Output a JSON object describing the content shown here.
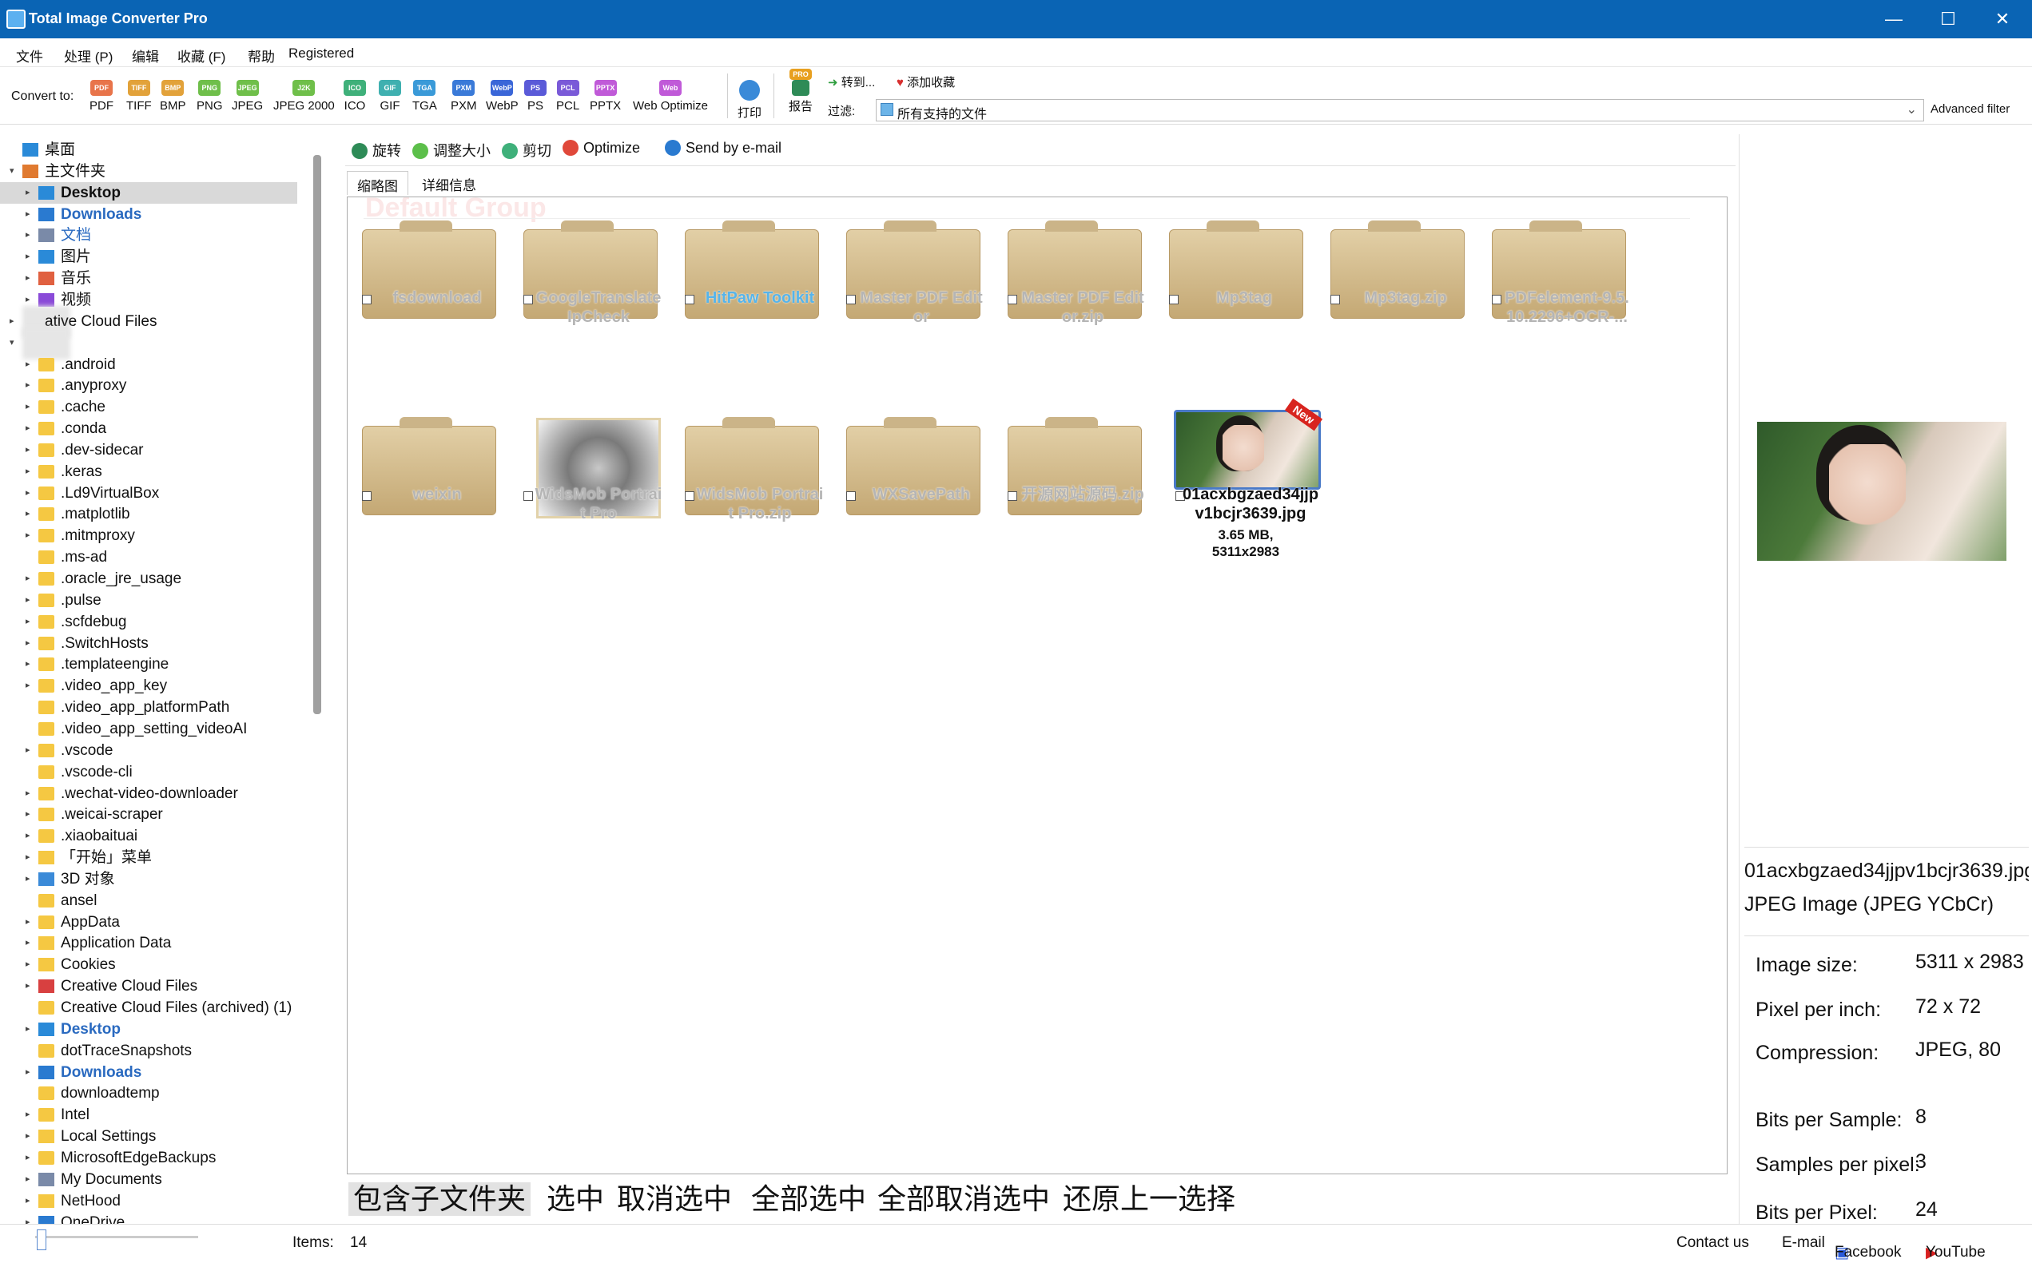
{
  "window": {
    "title": "Total Image Converter Pro",
    "minimize": "—",
    "maximize": "☐",
    "close": "✕"
  },
  "menu": [
    "文件",
    "处理 (P)",
    "编辑",
    "收藏 (F)",
    "帮助",
    "Registered"
  ],
  "toolbar": {
    "convert_to": "Convert to:",
    "formats": [
      {
        "label": "PDF",
        "icon": "PDF",
        "color": "#e8744a"
      },
      {
        "label": "TIFF",
        "icon": "TIFF",
        "color": "#e2a23a"
      },
      {
        "label": "BMP",
        "icon": "BMP",
        "color": "#e2a23a"
      },
      {
        "label": "PNG",
        "icon": "PNG",
        "color": "#6fbf4a"
      },
      {
        "label": "JPEG",
        "icon": "JPEG",
        "color": "#6fbf4a"
      },
      {
        "label": "JPEG 2000",
        "icon": "J2K",
        "color": "#6fbf4a"
      },
      {
        "label": "ICO",
        "icon": "ICO",
        "color": "#3fb07a"
      },
      {
        "label": "GIF",
        "icon": "GIF",
        "color": "#3fb0b0"
      },
      {
        "label": "TGA",
        "icon": "TGA",
        "color": "#3a9ad8"
      },
      {
        "label": "PXM",
        "icon": "PXM",
        "color": "#3a7ad8"
      },
      {
        "label": "WebP",
        "icon": "WebP",
        "color": "#3a66d8"
      },
      {
        "label": "PS",
        "icon": "PS",
        "color": "#5a5ad8"
      },
      {
        "label": "PCL",
        "icon": "PCL",
        "color": "#7a5ad8"
      },
      {
        "label": "PPTX",
        "icon": "PPTX",
        "color": "#c05ad8"
      },
      {
        "label": "Web Optimize",
        "icon": "Web",
        "color": "#c05ad8"
      }
    ],
    "print": "打印",
    "report": "报告",
    "pro_badge": "PRO",
    "goto": "转到...",
    "add_favorite": "添加收藏",
    "filter_label": "过滤:",
    "filter_value": "所有支持的文件",
    "advanced_filter": "Advanced filter"
  },
  "tree": {
    "items": [
      {
        "label": "桌面",
        "exp": "",
        "level": 0,
        "icon": "desktop"
      },
      {
        "label": "主文件夹",
        "exp": "▾",
        "level": 0,
        "icon": "home"
      },
      {
        "label": "Desktop",
        "exp": "▸",
        "level": 1,
        "icon": "desktop",
        "style": "selected"
      },
      {
        "label": "Downloads",
        "exp": "▸",
        "level": 1,
        "icon": "download",
        "style": "blue"
      },
      {
        "label": "文档",
        "exp": "▸",
        "level": 1,
        "icon": "doc",
        "style": "blue"
      },
      {
        "label": "图片",
        "exp": "▸",
        "level": 1,
        "icon": "pic"
      },
      {
        "label": "音乐",
        "exp": "▸",
        "level": 1,
        "icon": "music"
      },
      {
        "label": "视频",
        "exp": "▸",
        "level": 1,
        "icon": "video"
      },
      {
        "label": "ative Cloud Files",
        "exp": "▸",
        "level": 0,
        "icon": "blur"
      },
      {
        "label": "",
        "exp": "▾",
        "level": 0,
        "icon": "blur"
      },
      {
        "label": ".android",
        "exp": "▸",
        "level": 1,
        "icon": "folder"
      },
      {
        "label": ".anyproxy",
        "exp": "▸",
        "level": 1,
        "icon": "folder"
      },
      {
        "label": ".cache",
        "exp": "▸",
        "level": 1,
        "icon": "folder"
      },
      {
        "label": ".conda",
        "exp": "▸",
        "level": 1,
        "icon": "folder"
      },
      {
        "label": ".dev-sidecar",
        "exp": "▸",
        "level": 1,
        "icon": "folder"
      },
      {
        "label": ".keras",
        "exp": "▸",
        "level": 1,
        "icon": "folder"
      },
      {
        "label": ".Ld9VirtualBox",
        "exp": "▸",
        "level": 1,
        "icon": "folder"
      },
      {
        "label": ".matplotlib",
        "exp": "▸",
        "level": 1,
        "icon": "folder"
      },
      {
        "label": ".mitmproxy",
        "exp": "▸",
        "level": 1,
        "icon": "folder"
      },
      {
        "label": ".ms-ad",
        "exp": "",
        "level": 1,
        "icon": "folder"
      },
      {
        "label": ".oracle_jre_usage",
        "exp": "▸",
        "level": 1,
        "icon": "folder"
      },
      {
        "label": ".pulse",
        "exp": "▸",
        "level": 1,
        "icon": "folder"
      },
      {
        "label": ".scfdebug",
        "exp": "▸",
        "level": 1,
        "icon": "folder"
      },
      {
        "label": ".SwitchHosts",
        "exp": "▸",
        "level": 1,
        "icon": "folder"
      },
      {
        "label": ".templateengine",
        "exp": "▸",
        "level": 1,
        "icon": "folder"
      },
      {
        "label": ".video_app_key",
        "exp": "▸",
        "level": 1,
        "icon": "folder"
      },
      {
        "label": ".video_app_platformPath",
        "exp": "",
        "level": 1,
        "icon": "folder"
      },
      {
        "label": ".video_app_setting_videoAI",
        "exp": "",
        "level": 1,
        "icon": "folder"
      },
      {
        "label": ".vscode",
        "exp": "▸",
        "level": 1,
        "icon": "folder"
      },
      {
        "label": ".vscode-cli",
        "exp": "",
        "level": 1,
        "icon": "folder"
      },
      {
        "label": ".wechat-video-downloader",
        "exp": "▸",
        "level": 1,
        "icon": "folder"
      },
      {
        "label": ".weicai-scraper",
        "exp": "▸",
        "level": 1,
        "icon": "folder"
      },
      {
        "label": ".xiaobaituai",
        "exp": "▸",
        "level": 1,
        "icon": "folder"
      },
      {
        "label": "「开始」菜单",
        "exp": "▸",
        "level": 1,
        "icon": "link"
      },
      {
        "label": "3D 对象",
        "exp": "▸",
        "level": 1,
        "icon": "cube"
      },
      {
        "label": "ansel",
        "exp": "",
        "level": 1,
        "icon": "folder"
      },
      {
        "label": "AppData",
        "exp": "▸",
        "level": 1,
        "icon": "folder"
      },
      {
        "label": "Application Data",
        "exp": "▸",
        "level": 1,
        "icon": "link"
      },
      {
        "label": "Cookies",
        "exp": "▸",
        "level": 1,
        "icon": "link"
      },
      {
        "label": "Creative Cloud Files",
        "exp": "▸",
        "level": 1,
        "icon": "cc"
      },
      {
        "label": "Creative Cloud Files (archived) (1)",
        "exp": "",
        "level": 1,
        "icon": "folder"
      },
      {
        "label": "Desktop",
        "exp": "▸",
        "level": 1,
        "icon": "desktop",
        "style": "blue"
      },
      {
        "label": "dotTraceSnapshots",
        "exp": "",
        "level": 1,
        "icon": "folder"
      },
      {
        "label": "Downloads",
        "exp": "▸",
        "level": 1,
        "icon": "download",
        "style": "blue"
      },
      {
        "label": "downloadtemp",
        "exp": "",
        "level": 1,
        "icon": "folder"
      },
      {
        "label": "Intel",
        "exp": "▸",
        "level": 1,
        "icon": "folder"
      },
      {
        "label": "Local Settings",
        "exp": "▸",
        "level": 1,
        "icon": "link"
      },
      {
        "label": "MicrosoftEdgeBackups",
        "exp": "▸",
        "level": 1,
        "icon": "folder"
      },
      {
        "label": "My Documents",
        "exp": "▸",
        "level": 1,
        "icon": "doc"
      },
      {
        "label": "NetHood",
        "exp": "▸",
        "level": 1,
        "icon": "link"
      },
      {
        "label": "OneDrive",
        "exp": "▸",
        "level": 1,
        "icon": "cloud"
      }
    ]
  },
  "actions": [
    "旋转",
    "调整大小",
    "剪切",
    "Optimize",
    "Send by e-mail"
  ],
  "tabs": [
    "缩略图",
    "详细信息"
  ],
  "group_title": "Default Group",
  "thumbnails": [
    {
      "name": "fsdownload",
      "type": "folder"
    },
    {
      "name": "GoogleTranslateIpCheck",
      "type": "folder"
    },
    {
      "name": "HitPaw Toolkit",
      "type": "folder",
      "style": "blue"
    },
    {
      "name": "Master PDF Editor",
      "type": "folder"
    },
    {
      "name": "Master PDF Editor.zip",
      "type": "folder"
    },
    {
      "name": "Mp3tag",
      "type": "folder"
    },
    {
      "name": "Mp3tag.zip",
      "type": "folder"
    },
    {
      "name": "PDFelement-9.5.10.2296+OCR-...",
      "type": "folder"
    },
    {
      "name": "weixin",
      "type": "folder"
    },
    {
      "name": "WidsMob Portrait Pro",
      "type": "app"
    },
    {
      "name": "WidsMob Portrait Pro.zip",
      "type": "folder"
    },
    {
      "name": "WXSavePath",
      "type": "folder"
    },
    {
      "name": "开源网站源码.zip",
      "type": "folder"
    },
    {
      "name": "01acxbgzaed34jjpv1bcjr3639.jpg",
      "type": "image",
      "style": "dark",
      "size": "3.65 MB,",
      "dims": "5311x2983",
      "badge": "New"
    }
  ],
  "bottom_filter": [
    "包含子文件夹",
    "选中",
    "取消选中",
    "全部选中",
    "全部取消选中",
    "还原上一选择"
  ],
  "status": {
    "items_label": "Items:",
    "items_count": "14",
    "contact": "Contact us",
    "email": "E-mail",
    "facebook": "Facebook",
    "youtube": "YouTube"
  },
  "preview": {
    "filename": "01acxbgzaed34jjpv1bcjr3639.jpg",
    "format": "JPEG Image (JPEG YCbCr)",
    "props": [
      {
        "k": "Image size:",
        "v": "5311 x 2983"
      },
      {
        "k": "Pixel per inch:",
        "v": "72 x 72"
      },
      {
        "k": "Compression:",
        "v": "JPEG, 80"
      },
      {
        "k": "Bits per Sample:",
        "v": "8"
      },
      {
        "k": "Samples per pixel:",
        "v": "3"
      },
      {
        "k": "Bits per Pixel:",
        "v": "24"
      }
    ]
  }
}
